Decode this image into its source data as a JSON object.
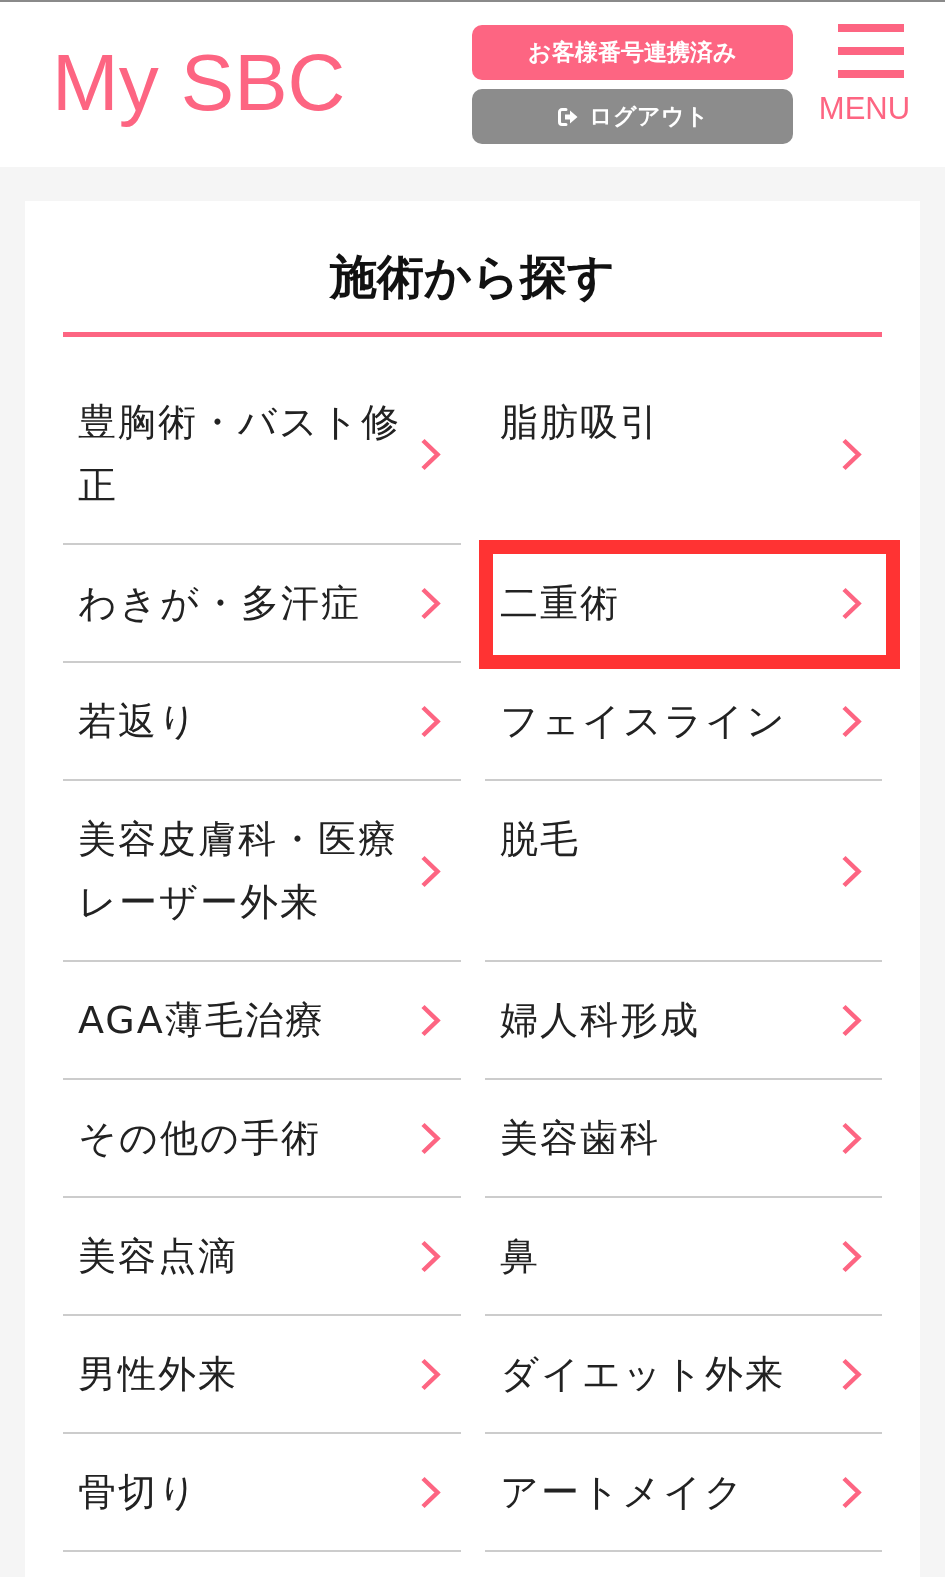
{
  "header": {
    "logo": "My SBC",
    "linked_button": "お客様番号連携済み",
    "logout_button": "ログアウト",
    "menu_label": "MENU"
  },
  "section": {
    "title": "施術から探す",
    "categories": [
      {
        "label": "豊胸術・バスト修正",
        "highlighted": false
      },
      {
        "label": "脂肪吸引",
        "highlighted": false
      },
      {
        "label": "わきが・多汗症",
        "highlighted": false
      },
      {
        "label": "二重術",
        "highlighted": true
      },
      {
        "label": "若返り",
        "highlighted": false
      },
      {
        "label": "フェイスライン",
        "highlighted": false
      },
      {
        "label": "美容皮膚科・医療レーザー外来",
        "highlighted": false
      },
      {
        "label": "脱毛",
        "highlighted": false
      },
      {
        "label": "AGA薄毛治療",
        "highlighted": false
      },
      {
        "label": "婦人科形成",
        "highlighted": false
      },
      {
        "label": "その他の手術",
        "highlighted": false
      },
      {
        "label": "美容歯科",
        "highlighted": false
      },
      {
        "label": "美容点滴",
        "highlighted": false
      },
      {
        "label": "鼻",
        "highlighted": false
      },
      {
        "label": "男性外来",
        "highlighted": false
      },
      {
        "label": "ダイエット外来",
        "highlighted": false
      },
      {
        "label": "骨切り",
        "highlighted": false
      },
      {
        "label": "アートメイク",
        "highlighted": false
      }
    ]
  }
}
